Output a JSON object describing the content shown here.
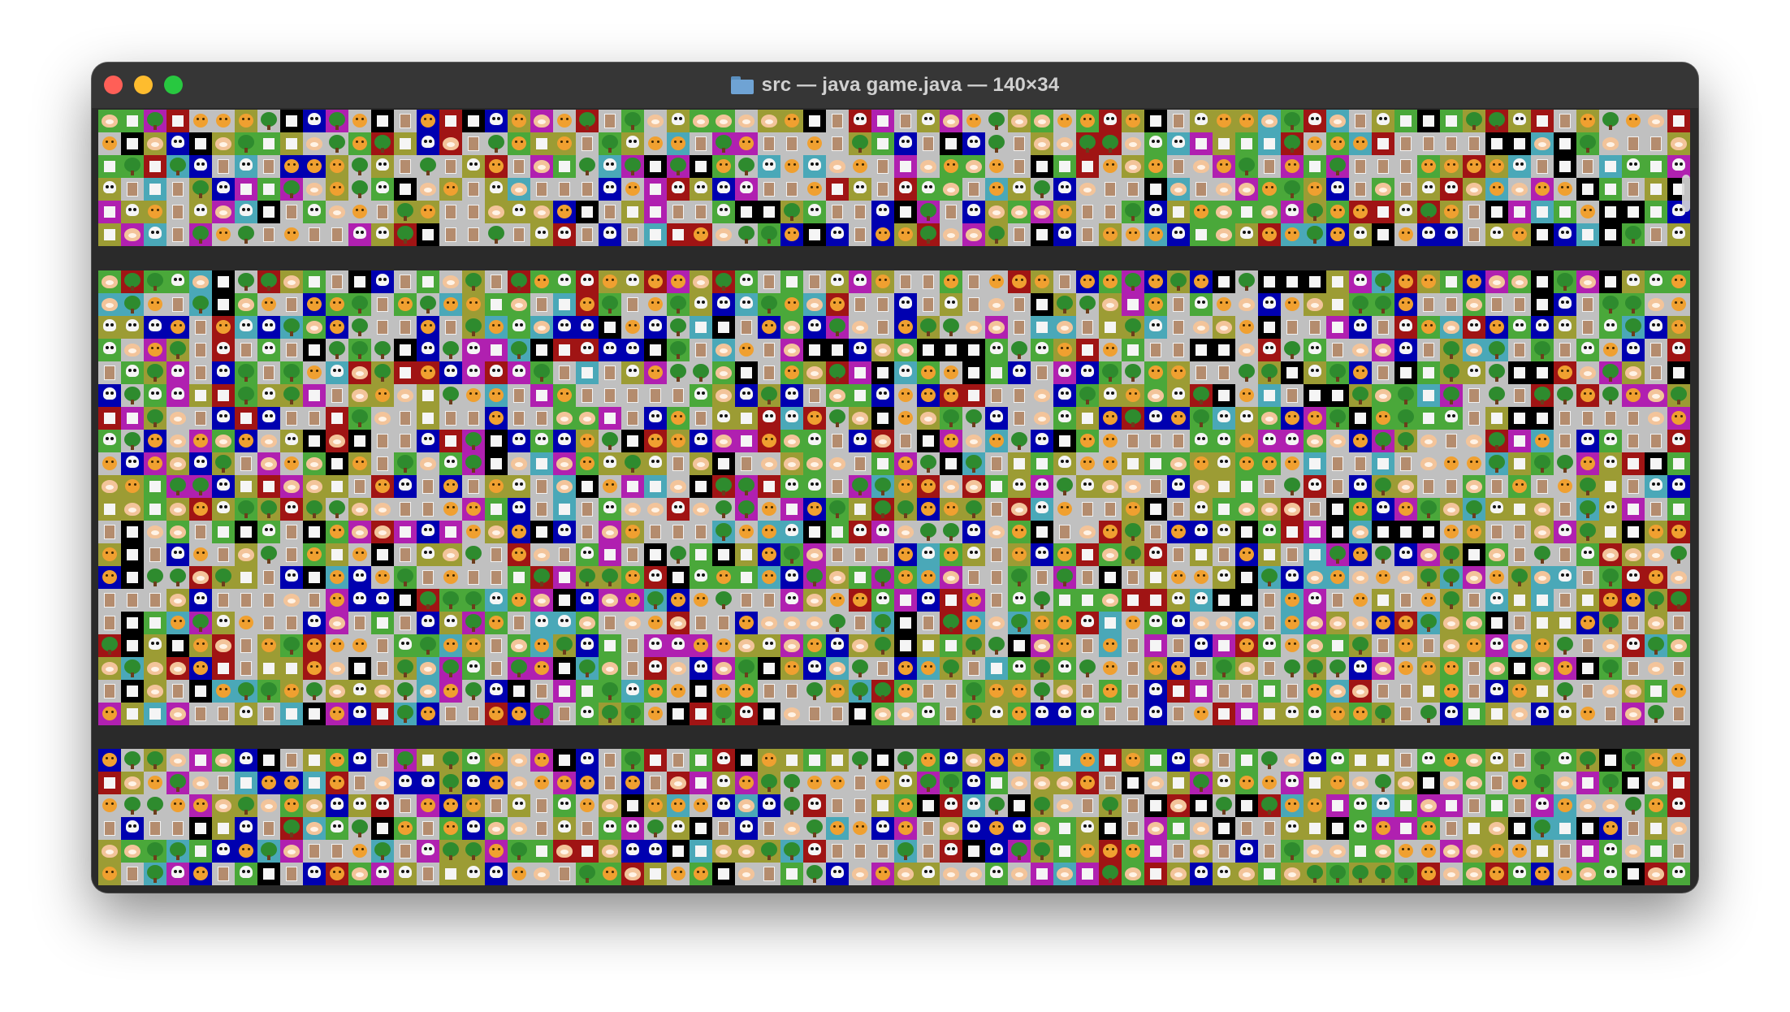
{
  "window": {
    "title": "src — java game.java — 140×34",
    "folder_icon": "folder-icon",
    "buttons": [
      "close",
      "minimize",
      "maximize"
    ]
  },
  "terminal": {
    "bands": [
      {
        "name": "band-top",
        "rows": 6
      },
      {
        "name": "band-middle",
        "rows": 20
      },
      {
        "name": "band-bottom",
        "rows": 6
      }
    ]
  },
  "colors": {
    "grey": "#c0c0c0",
    "olive": "#9c9c34",
    "green": "#4aa83a",
    "magenta": "#b020b0",
    "blue": "#0000b0",
    "black": "#000000",
    "darkred": "#a01414",
    "cyan": "#4aa8b8",
    "window_bg": "#2a2a2a",
    "titlebar_bg": "#363636"
  },
  "tile_icons": [
    "brown-square",
    "cat-face-icon",
    "hamster-icon",
    "tree-icon",
    "skull-icon",
    "white-block",
    "leaf-icon"
  ]
}
